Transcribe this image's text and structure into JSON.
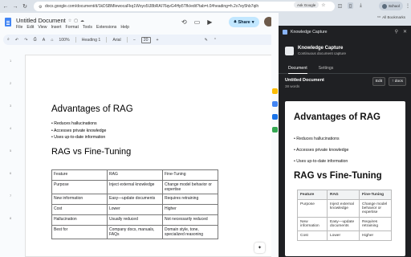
{
  "browser": {
    "url": "docs.google.com/document/d/1kDSBMlewocaFkq1Woyo5lJ8bRAI76qvG4Hp5Tfk/edit?tab=t.0#heading=h.2x7ey5hb7qih",
    "ask_google_label": "Ask Google",
    "profile_label": "School",
    "all_bookmarks_label": "All Bookmarks"
  },
  "docs": {
    "title": "Untitled Document",
    "menu": [
      "File",
      "Edit",
      "View",
      "Insert",
      "Format",
      "Tools",
      "Extensions",
      "Help"
    ],
    "share_label": "Share",
    "toolbar": {
      "zoom": "100%",
      "style": "Heading 1",
      "font": "Arial",
      "font_size": "20"
    },
    "ruler_marks": [
      "1",
      "2",
      "3",
      "4",
      "5",
      "6",
      "7",
      "8"
    ],
    "content": {
      "heading1": "Advantages of RAG",
      "bullets": [
        "Reduces hallucinations",
        "Accesses private knowledge",
        "Uses up-to-date information"
      ],
      "heading2": "RAG vs Fine-Tuning",
      "table": [
        [
          "Feature",
          "RAG",
          "Fine-Tuning"
        ],
        [
          "Purpose",
          "Inject external knowledge",
          "Change model behavior or expertise"
        ],
        [
          "New information",
          "Easy—update documents",
          "Requires retraining"
        ],
        [
          "Cost",
          "Lower",
          "Higher"
        ],
        [
          "Hallucination",
          "Usually reduced",
          "Not necessarily reduced"
        ],
        [
          "Best for",
          "Company docs, manuals, FAQs",
          "Domain style, tone, specialized reasoning"
        ]
      ]
    }
  },
  "panel": {
    "header_title": "Knowledge Capture",
    "app_title": "Knowledge Capture",
    "app_subtitle": "Continuous document capture",
    "tabs": [
      "Document",
      "Settings"
    ],
    "doc_name": "Untitled Document",
    "word_count": "38 words",
    "edit_label": "Edit",
    "docs_label": "↑ docs",
    "preview": {
      "heading1": "Advantages of RAG",
      "bullets": [
        "Reduces hallucinations",
        "Accesses private knowledge",
        "Uses up-to-date information"
      ],
      "heading2": "RAG vs Fine-Tuning",
      "table": [
        [
          "Feature",
          "RAG",
          "Fine-Tuning"
        ],
        [
          "Purpose",
          "Inject external knowledge",
          "Change model behavior or expertise"
        ],
        [
          "New information",
          "Easy—update documents",
          "Requires retraining"
        ],
        [
          "Cost",
          "Lower",
          "Higher"
        ]
      ]
    }
  },
  "colors": {
    "share_bg": "#c2e7ff",
    "panel_bg": "#1f2023",
    "docs_blue": "#4285f4"
  }
}
